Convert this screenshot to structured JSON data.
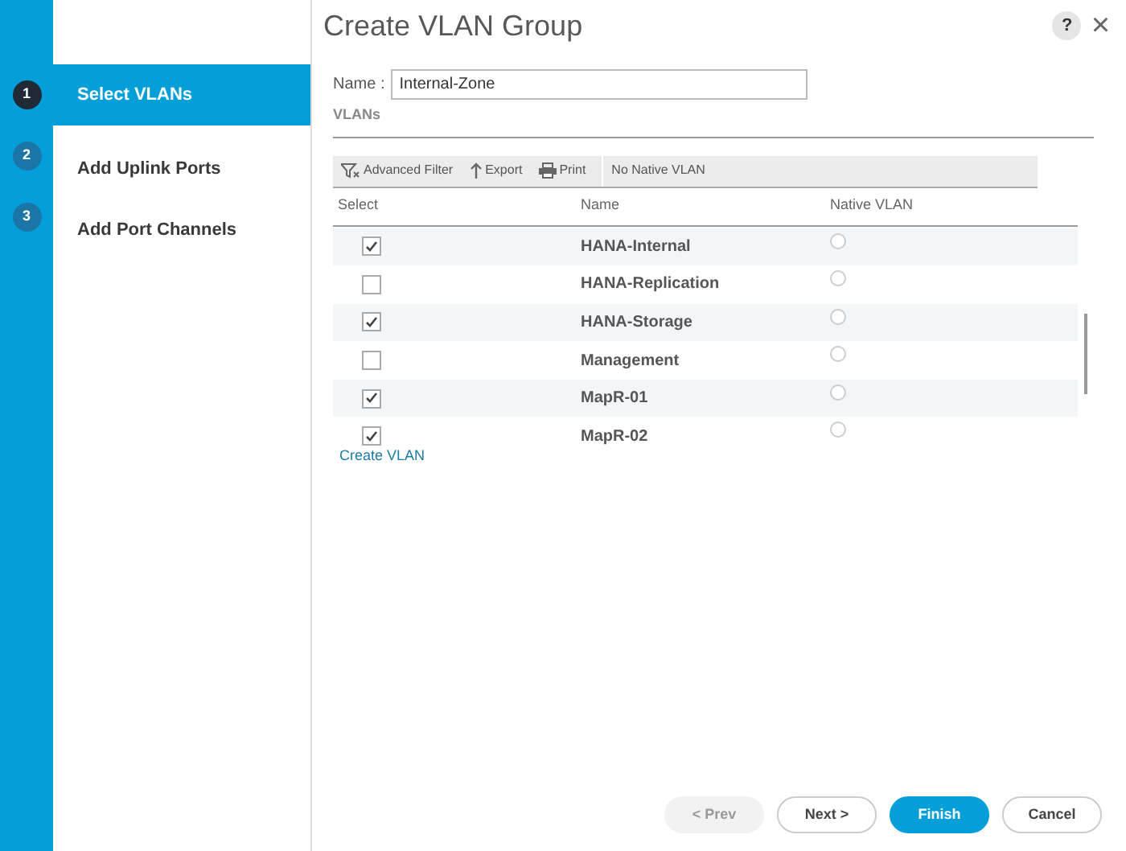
{
  "window": {
    "title": "Create VLAN Group",
    "help": "?",
    "close": "×"
  },
  "steps": [
    {
      "number": "1",
      "label": "Select VLANs",
      "selected": true
    },
    {
      "number": "2",
      "label": "Add Uplink Ports",
      "selected": false
    },
    {
      "number": "3",
      "label": "Add Port Channels",
      "selected": false
    }
  ],
  "name_field": {
    "label": "Name :",
    "value": "Internal-Zone"
  },
  "section_title": "VLANs",
  "toolbar": {
    "actions": [
      {
        "kind": "filter",
        "label": "Advanced Filter"
      },
      {
        "kind": "export",
        "label": "Export"
      },
      {
        "kind": "print",
        "label": "Print"
      }
    ],
    "native_vlan": "No Native VLAN"
  },
  "table": {
    "columns": [
      "Select",
      "Name",
      "Native VLAN"
    ],
    "rows": [
      {
        "name": "HANA-Internal",
        "checked": true,
        "native": false
      },
      {
        "name": "HANA-Replication",
        "checked": false,
        "native": false
      },
      {
        "name": "HANA-Storage",
        "checked": true,
        "native": false
      },
      {
        "name": "Management",
        "checked": false,
        "native": false
      },
      {
        "name": "MapR-01",
        "checked": true,
        "native": false
      },
      {
        "name": "MapR-02",
        "checked": true,
        "native": false
      }
    ]
  },
  "create_link": "Create VLAN",
  "buttons": [
    {
      "kind": "secondary",
      "label": "< Prev",
      "disabled": true
    },
    {
      "kind": "secondary",
      "label": "Next >",
      "disabled": false
    },
    {
      "kind": "primary",
      "label": "Finish",
      "disabled": false
    },
    {
      "kind": "secondary",
      "label": "Cancel",
      "disabled": false
    }
  ]
}
